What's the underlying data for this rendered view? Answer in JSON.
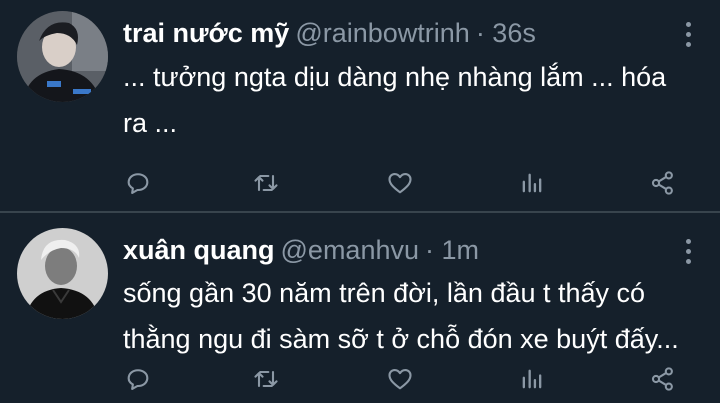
{
  "tweets": [
    {
      "display_name": "trai nước mỹ",
      "handle": "@rainbowtrinh",
      "time": "· 36s",
      "text": "... tưởng ngta dịu dàng nhẹ nhàng lắm ... hóa ra ..."
    },
    {
      "display_name": "xuân quang",
      "handle": "@emanhvu",
      "time": "· 1m",
      "text": "sống gần 30 năm trên đời, lần đầu t thấy có thằng ngu đi sàm sỡ t ở chỗ đón xe buýt đấy..."
    }
  ],
  "icons": {
    "reply": "reply-icon",
    "retweet": "retweet-icon",
    "like": "heart-icon",
    "stats": "bar-chart-icon",
    "share": "share-icon",
    "more": "more-vertical-icon"
  },
  "colors": {
    "background": "#15202b",
    "divider": "#38444d",
    "text_primary": "#ffffff",
    "text_secondary": "#8b98a5"
  }
}
